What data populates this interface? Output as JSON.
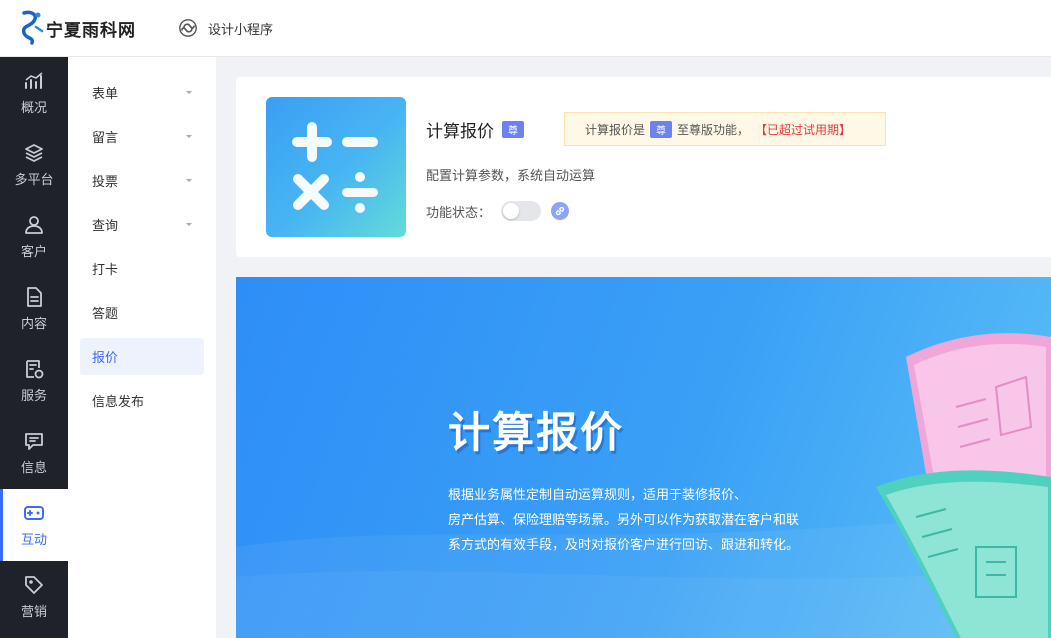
{
  "header": {
    "logo_text": "宁夏雨科网",
    "design_link": "设计小程序"
  },
  "nav": {
    "items": [
      {
        "label": "概况"
      },
      {
        "label": "多平台"
      },
      {
        "label": "客户"
      },
      {
        "label": "内容"
      },
      {
        "label": "服务"
      },
      {
        "label": "信息"
      },
      {
        "label": "互动",
        "active": true
      },
      {
        "label": "营销"
      }
    ]
  },
  "subnav": {
    "items": [
      {
        "label": "表单",
        "has_caret": true
      },
      {
        "label": "留言",
        "has_caret": true
      },
      {
        "label": "投票",
        "has_caret": true
      },
      {
        "label": "查询",
        "has_caret": true
      },
      {
        "label": "打卡"
      },
      {
        "label": "答题"
      },
      {
        "label": "报价",
        "active": true
      },
      {
        "label": "信息发布"
      }
    ]
  },
  "card": {
    "title": "计算报价",
    "badge": "尊",
    "notice_prefix": "计算报价是",
    "notice_badge": "尊",
    "notice_suffix": "至尊版功能，",
    "notice_warn": "【已超过试用期】",
    "description": "配置计算参数，系统自动运算",
    "status_label": "功能状态：",
    "status_on": false
  },
  "banner": {
    "title": "计算报价",
    "line1": "根据业务属性定制自动运算规则，适用于装修报价、",
    "line2": "房产估算、保险理赔等场景。另外可以作为获取潜在客户和联",
    "line3": "系方式的有效手段，及时对报价客户进行回访、跟进和转化。"
  },
  "colors": {
    "accent": "#3a6cf4",
    "nav_bg": "#1f2229",
    "warn": "#e23b3b",
    "badge": "#6b82f0"
  }
}
